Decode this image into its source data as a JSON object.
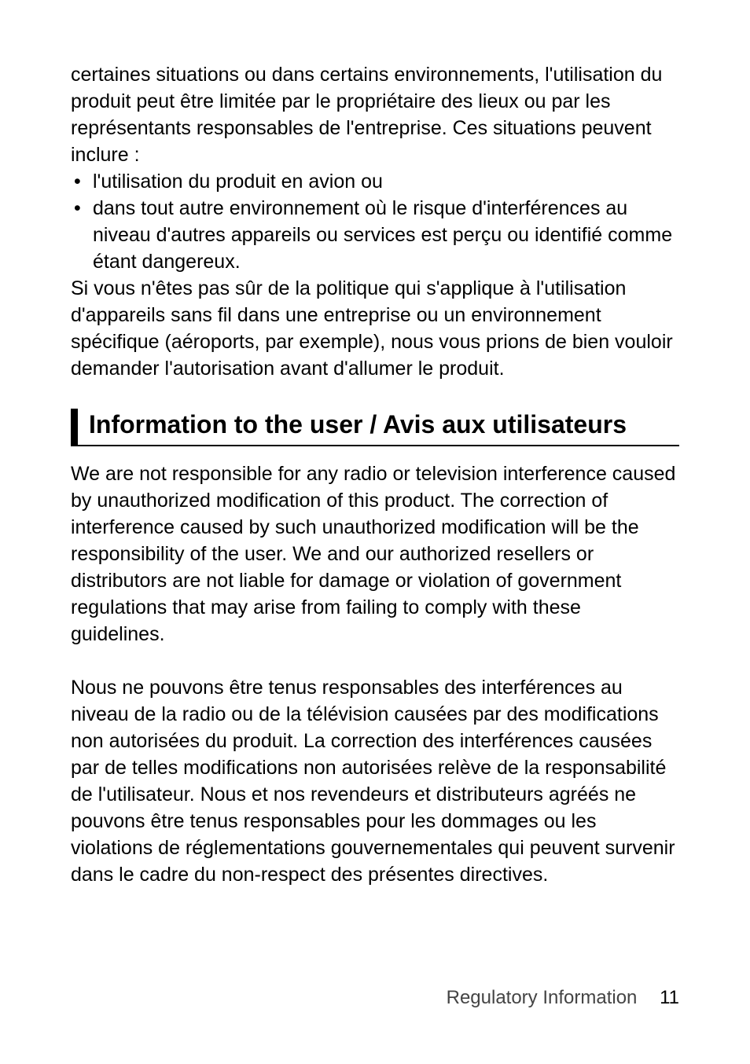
{
  "intro_paragraph": "certaines situations ou dans certains environnements, l'utilisation du produit peut être limitée par le propriétaire des lieux ou par les représentants responsables de l'entreprise. Ces situations peuvent inclure :",
  "bullets": [
    "l'utilisation du produit en avion ou",
    "dans tout autre environnement où le risque d'interférences au niveau d'autres appareils ou services est perçu ou identifié comme étant dangereux."
  ],
  "after_bullets": "Si vous n'êtes pas sûr de la politique qui s'applique à l'utilisation d'appareils sans fil dans une entreprise ou un environnement spécifique (aéroports, par exemple), nous vous prions de bien vouloir demander l'autorisation avant d'allumer le produit.",
  "heading": "Information to the user / Avis aux utilisateurs",
  "para_en": "We are not responsible for any radio or television interference caused by unauthorized modification of this product. The correction of interference caused by such unauthorized modification will be the responsibility of the user. We and our authorized resellers or distributors are not liable for damage or violation of government regulations that may arise from failing to comply with these guidelines.",
  "para_fr": "Nous ne pouvons être tenus responsables des interférences au niveau de la radio ou de la télévision causées par des modifications non autorisées du produit. La correction des interférences causées par de telles modifications non autorisées relève de la responsabilité de l'utilisateur. Nous et nos revendeurs et distributeurs agréés ne pouvons être tenus responsables pour les dommages ou les violations de réglementations gouvernementales qui peuvent survenir dans le cadre du non-respect des présentes directives.",
  "footer_label": "Regulatory Information",
  "page_number": "11"
}
